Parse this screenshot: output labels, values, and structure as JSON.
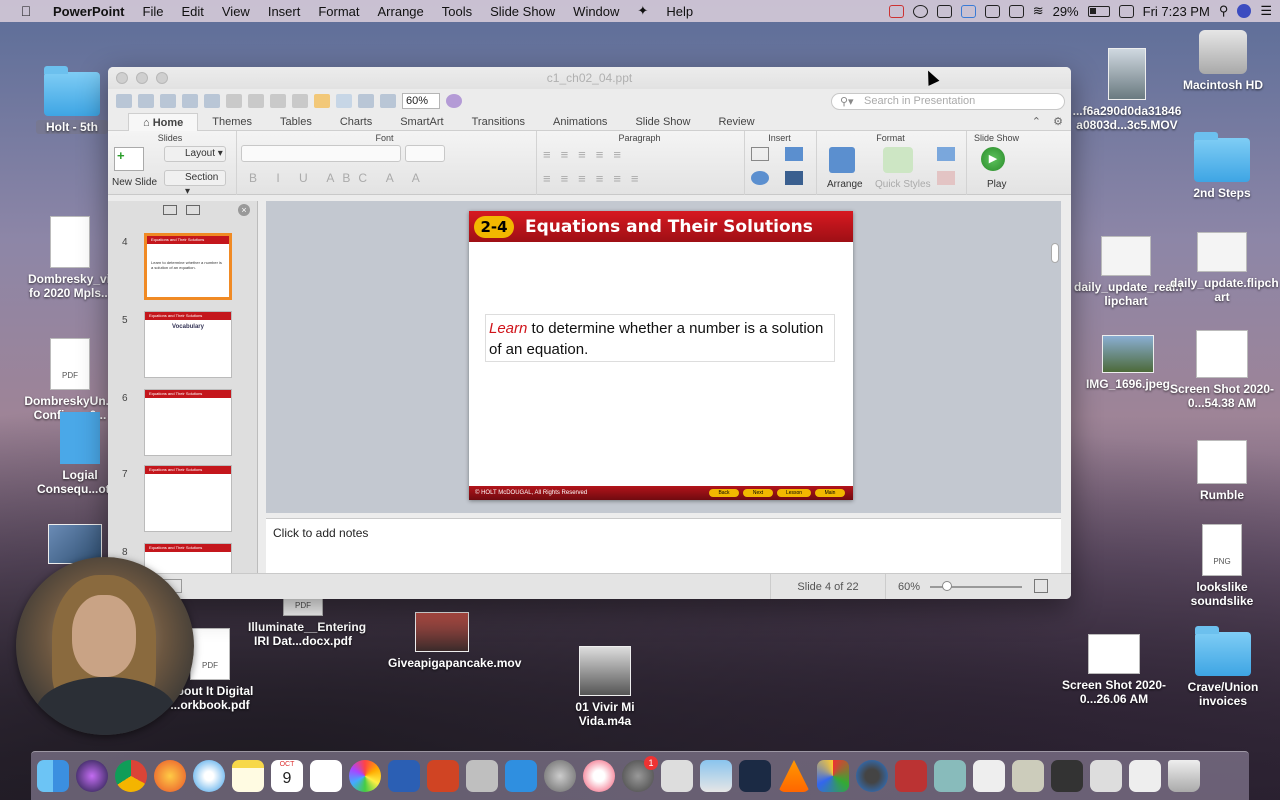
{
  "menubar": {
    "app": "PowerPoint",
    "items": [
      "File",
      "Edit",
      "View",
      "Insert",
      "Format",
      "Arrange",
      "Tools",
      "Slide Show",
      "Window",
      "Help"
    ],
    "battery": "29%",
    "clock": "Fri 7:23 PM"
  },
  "window": {
    "title": "c1_ch02_04.ppt",
    "zoom": "60%",
    "search_placeholder": "Search in Presentation",
    "tabs": [
      "Home",
      "Themes",
      "Tables",
      "Charts",
      "SmartArt",
      "Transitions",
      "Animations",
      "Slide Show",
      "Review"
    ],
    "active_tab": "Home",
    "ribbon": {
      "slides_group": "Slides",
      "new_slide": "New Slide",
      "layout": "Layout",
      "section": "Section",
      "font_group": "Font",
      "paragraph_group": "Paragraph",
      "insert_group": "Insert",
      "format_group": "Format",
      "arrange": "Arrange",
      "quick_styles": "Quick Styles",
      "slideshow_group": "Slide Show",
      "play": "Play"
    },
    "thumbnails": [
      {
        "num": "4",
        "title": "Equations and Their Solutions",
        "text": "Learn to determine whether a number is a solution of an equation."
      },
      {
        "num": "5",
        "title": "Equations and Their Solutions",
        "text": "Vocabulary"
      },
      {
        "num": "6",
        "title": "Equations and Their Solutions",
        "text": ""
      },
      {
        "num": "7",
        "title": "Equations and Their Solutions",
        "text": ""
      },
      {
        "num": "8",
        "title": "Equations and Their Solutions",
        "text": ""
      }
    ],
    "slide": {
      "badge": "2-4",
      "title": "Equations and Their Solutions",
      "objective_em": "Learn",
      "objective_rest": " to determine whether a number is a solution of an equation.",
      "footer": "© HOLT McDOUGAL, All Rights Reserved",
      "nav": [
        "Back",
        "Next",
        "Lesson",
        "Main"
      ]
    },
    "notes_placeholder": "Click to add notes",
    "status": {
      "slide": "Slide 4 of 22",
      "zoom": "60%"
    }
  },
  "desktop": {
    "icons": [
      {
        "label": "Holt - 5th"
      },
      {
        "label": "Dombresky_vi... fo 2020 Mpls..."
      },
      {
        "label": "DombreskyUn... Confirm...0..."
      },
      {
        "label": "Logial Consequ...otes"
      },
      {
        "label": "...bout It Digital ...orkbook.pdf"
      },
      {
        "label": "Illuminate__Entering IRI Dat...docx.pdf"
      },
      {
        "label": "Giveapigapancake.mov"
      },
      {
        "label": "01 Vivir Mi Vida.m4a"
      },
      {
        "label": "...f6a290d0da31846 a0803d...3c5.MOV"
      },
      {
        "label": "Macintosh HD"
      },
      {
        "label": "2nd Steps"
      },
      {
        "label": "daily_update_real.f lipchart"
      },
      {
        "label": "daily_update.flipch art"
      },
      {
        "label": "IMG_1696.jpeg"
      },
      {
        "label": "Screen Shot 2020-0...54.38 AM"
      },
      {
        "label": "Rumble"
      },
      {
        "label": "lookslike soundslike"
      },
      {
        "label": "Screen Shot 2020-0...26.06 AM"
      },
      {
        "label": "Crave/Union invoices"
      }
    ]
  },
  "dock": {
    "calendar_month": "OCT",
    "calendar_day": "9",
    "badge": "1"
  }
}
